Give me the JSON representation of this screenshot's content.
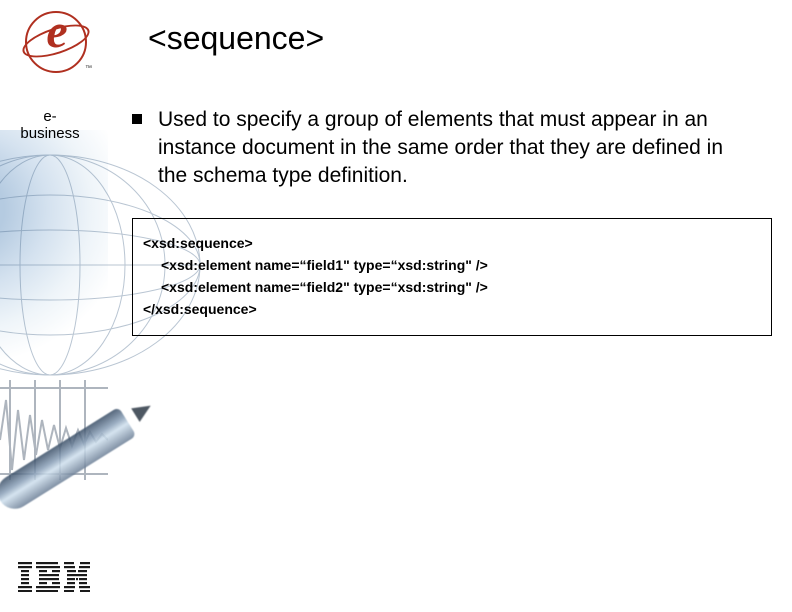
{
  "sidebar": {
    "logo_glyph": "e",
    "logo_tm": "™",
    "label_line1": "e-",
    "label_line2": "business",
    "footer_brand_aria": "IBM"
  },
  "title": "<sequence>",
  "bullet": "Used to specify a group of elements that must appear in an instance document in the same order that they are defined in the schema type definition.",
  "code": {
    "l1": "<xsd:sequence>",
    "l2": "<xsd:element name=“field1\" type=“xsd:string\" />",
    "l3": "<xsd:element name=“field2\" type=“xsd:string\" />",
    "l4": "</xsd:sequence>"
  }
}
